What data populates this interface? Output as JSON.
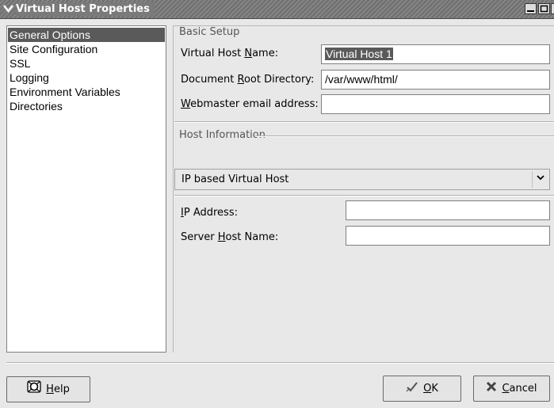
{
  "window": {
    "title": "Virtual Host Properties",
    "menu_icon": "chevron-down-icon",
    "controls": {
      "minimize": "▁",
      "maximize": "□",
      "close": "✕"
    }
  },
  "sidebar": {
    "items": [
      {
        "label": "General Options",
        "selected": true
      },
      {
        "label": "Site Configuration",
        "selected": false
      },
      {
        "label": "SSL",
        "selected": false
      },
      {
        "label": "Logging",
        "selected": false
      },
      {
        "label": "Environment Variables",
        "selected": false
      },
      {
        "label": "Directories",
        "selected": false
      }
    ]
  },
  "basic_setup": {
    "title": "Basic Setup",
    "vhost_name_label_pre": "Virtual Host ",
    "vhost_name_label_u": "N",
    "vhost_name_label_post": "ame:",
    "vhost_name_value": "Virtual Host 1",
    "docroot_label_pre": "Document ",
    "docroot_label_u": "R",
    "docroot_label_post": "oot Directory:",
    "docroot_value": "/var/www/html/",
    "webmaster_label_u": "W",
    "webmaster_label_post": "ebmaster email address:",
    "webmaster_value": ""
  },
  "host_info": {
    "title": "Host Information",
    "type_selected": "IP based Virtual Host",
    "ip_label_u": "I",
    "ip_label_post": "P Address:",
    "ip_value": "",
    "server_name_label_pre": "Server ",
    "server_name_label_u": "H",
    "server_name_label_post": "ost Name:",
    "server_name_value": ""
  },
  "buttons": {
    "help_u": "H",
    "help_post": "elp",
    "ok_u": "O",
    "ok_post": "K",
    "cancel_u": "C",
    "cancel_post": "ancel"
  }
}
